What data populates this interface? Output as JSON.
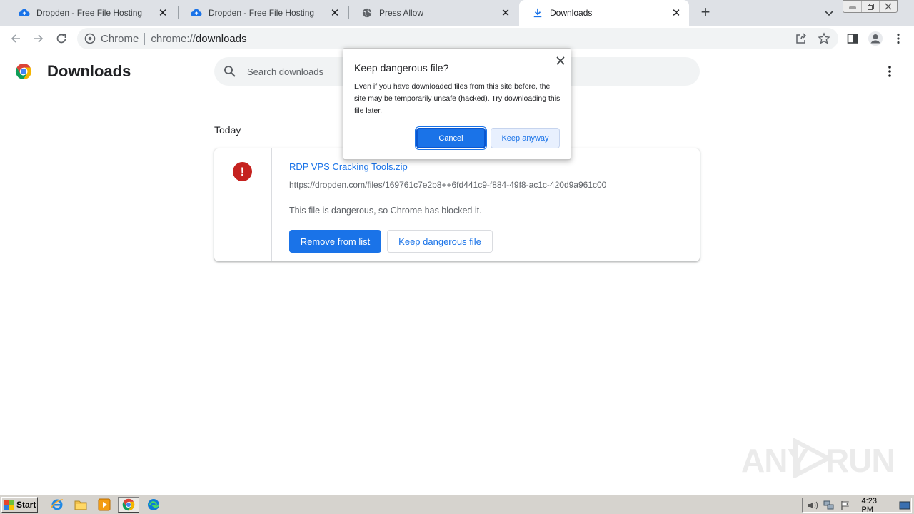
{
  "tabs": [
    {
      "title": "Dropden - Free File Hosting",
      "icon": "cloud-upload-icon"
    },
    {
      "title": "Dropden - Free File Hosting",
      "icon": "cloud-upload-icon"
    },
    {
      "title": "Press Allow",
      "icon": "globe-icon"
    },
    {
      "title": "Downloads",
      "icon": "download-icon",
      "active": true
    }
  ],
  "toolbar": {
    "chip_label": "Chrome",
    "url_scheme": "chrome://",
    "url_host": "downloads"
  },
  "page": {
    "title": "Downloads",
    "search_placeholder": "Search downloads",
    "date_heading": "Today"
  },
  "download_item": {
    "file_name": "RDP VPS Cracking Tools.zip",
    "url": "https://dropden.com/files/169761c7e2b8++6fd441c9-f884-49f8-ac1c-420d9a961c00",
    "status": "This file is dangerous, so Chrome has blocked it.",
    "remove_label": "Remove from list",
    "keep_label": "Keep dangerous file",
    "danger_glyph": "!"
  },
  "dialog": {
    "title": "Keep dangerous file?",
    "body": "Even if you have downloaded files from this site before, the site may be temporarily unsafe (hacked). Try downloading this file later.",
    "cancel_label": "Cancel",
    "keep_label": "Keep anyway"
  },
  "watermark": {
    "left_text": "ANY",
    "right_text": "RUN"
  },
  "taskbar": {
    "start_label": "Start",
    "clock": "4:23 PM",
    "pinned": [
      "internet-explorer-icon",
      "file-explorer-icon",
      "media-player-icon",
      "chrome-icon",
      "edge-icon"
    ]
  },
  "colors": {
    "accent": "#1a73e8",
    "danger": "#c5221f",
    "tabstrip": "#dee1e6",
    "taskbar": "#d6d3ce"
  }
}
